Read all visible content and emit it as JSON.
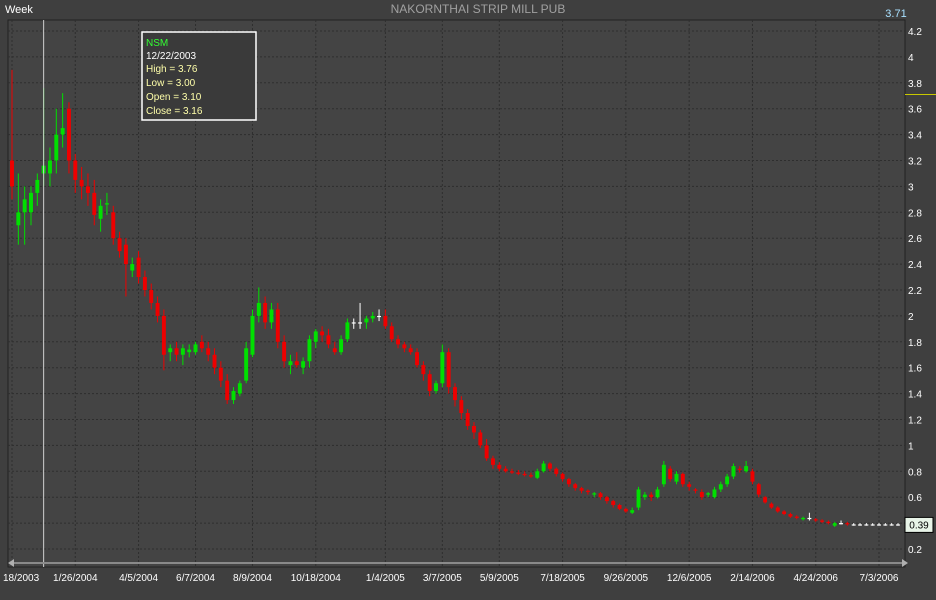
{
  "header": {
    "period_label": "Week",
    "title": "NAKORNTHAI STRIP MILL PUB",
    "last_value": "3.71"
  },
  "colors": {
    "background": "#3f3f3f",
    "plot_background": "#444444",
    "grid": "#2e2e2e",
    "up_candle": "#00e000",
    "down_candle": "#ee0000",
    "neutral_candle": "#ffffff",
    "axis_text": "#ffffff",
    "title_text": "#a0a0a0",
    "tooltip_symbol": "#33ff33",
    "tooltip_text": "#ffffaa",
    "current_price_line": "#c8c800",
    "last_badge_bg": "#e8f4e8",
    "crosshair": "#d0d0d0"
  },
  "tooltip": {
    "symbol": "NSM",
    "date": "12/22/2003",
    "high": "High  = 3.76",
    "low": "Low   = 3.00",
    "open": "Open = 3.10",
    "close": "Close = 3.16"
  },
  "last_price_badge": "0.39",
  "chart_data": {
    "type": "candlestick",
    "title": "NAKORNTHAI STRIP MILL PUB",
    "symbol": "NSM",
    "period": "Week",
    "ylim": [
      0.1,
      4.3
    ],
    "yticks": [
      0.2,
      0.4,
      0.6,
      0.8,
      1,
      1.2,
      1.4,
      1.6,
      1.8,
      2,
      2.2,
      2.4,
      2.6,
      2.8,
      3,
      3.2,
      3.4,
      3.6,
      3.8,
      4,
      4.2
    ],
    "ytick_labels": [
      "0.2",
      "0.4",
      "0.6",
      "0.8",
      "1",
      "1.2",
      "1.4",
      "1.6",
      "1.8",
      "2",
      "2.2",
      "2.4",
      "2.6",
      "2.8",
      "3",
      "3.2",
      "3.4",
      "3.6",
      "3.8",
      "4",
      "4.2"
    ],
    "xtick_labels": [
      "18/2003",
      "1/26/2004",
      "4/5/2004",
      "6/7/2004",
      "8/9/2004",
      "10/18/2004",
      "1/4/2005",
      "3/7/2005",
      "5/9/2005",
      "7/18/2005",
      "9/26/2005",
      "12/6/2005",
      "2/14/2006",
      "4/24/2006",
      "7/3/2006"
    ],
    "xtick_index": [
      0,
      10,
      20,
      29,
      38,
      48,
      59,
      68,
      77,
      87,
      97,
      107,
      117,
      127,
      137
    ],
    "highlight_index": 5,
    "current_price": 3.71,
    "last_close": 0.39,
    "ohlc": [
      {
        "o": 3.2,
        "h": 3.9,
        "l": 2.9,
        "c": 3.0
      },
      {
        "o": 2.7,
        "h": 3.1,
        "l": 2.55,
        "c": 2.8
      },
      {
        "o": 2.8,
        "h": 3.0,
        "l": 2.55,
        "c": 2.9
      },
      {
        "o": 2.8,
        "h": 3.0,
        "l": 2.7,
        "c": 2.95
      },
      {
        "o": 2.95,
        "h": 3.1,
        "l": 2.85,
        "c": 3.05
      },
      {
        "o": 3.1,
        "h": 3.76,
        "l": 3.0,
        "c": 3.16
      },
      {
        "o": 3.1,
        "h": 3.3,
        "l": 3.0,
        "c": 3.2
      },
      {
        "o": 3.2,
        "h": 3.6,
        "l": 3.1,
        "c": 3.4
      },
      {
        "o": 3.4,
        "h": 3.72,
        "l": 3.3,
        "c": 3.45
      },
      {
        "o": 3.6,
        "h": 3.65,
        "l": 3.1,
        "c": 3.2
      },
      {
        "o": 3.2,
        "h": 3.25,
        "l": 2.95,
        "c": 3.05
      },
      {
        "o": 3.05,
        "h": 3.15,
        "l": 2.9,
        "c": 3.0
      },
      {
        "o": 3.0,
        "h": 3.1,
        "l": 2.85,
        "c": 2.95
      },
      {
        "o": 2.95,
        "h": 3.05,
        "l": 2.7,
        "c": 2.78
      },
      {
        "o": 2.75,
        "h": 2.9,
        "l": 2.65,
        "c": 2.85
      },
      {
        "o": 2.86,
        "h": 2.95,
        "l": 2.78,
        "c": 2.87
      },
      {
        "o": 2.8,
        "h": 2.85,
        "l": 2.55,
        "c": 2.6
      },
      {
        "o": 2.6,
        "h": 2.65,
        "l": 2.45,
        "c": 2.5
      },
      {
        "o": 2.55,
        "h": 2.6,
        "l": 2.15,
        "c": 2.4
      },
      {
        "o": 2.35,
        "h": 2.45,
        "l": 2.3,
        "c": 2.4
      },
      {
        "o": 2.45,
        "h": 2.5,
        "l": 2.25,
        "c": 2.3
      },
      {
        "o": 2.3,
        "h": 2.35,
        "l": 2.15,
        "c": 2.2
      },
      {
        "o": 2.2,
        "h": 2.25,
        "l": 2.05,
        "c": 2.1
      },
      {
        "o": 2.1,
        "h": 2.15,
        "l": 1.95,
        "c": 2.0
      },
      {
        "o": 2.0,
        "h": 2.05,
        "l": 1.58,
        "c": 1.7
      },
      {
        "o": 1.72,
        "h": 1.78,
        "l": 1.65,
        "c": 1.75
      },
      {
        "o": 1.75,
        "h": 1.8,
        "l": 1.65,
        "c": 1.7
      },
      {
        "o": 1.7,
        "h": 1.78,
        "l": 1.62,
        "c": 1.75
      },
      {
        "o": 1.72,
        "h": 1.78,
        "l": 1.68,
        "c": 1.74
      },
      {
        "o": 1.72,
        "h": 1.8,
        "l": 1.7,
        "c": 1.78
      },
      {
        "o": 1.8,
        "h": 1.85,
        "l": 1.72,
        "c": 1.75
      },
      {
        "o": 1.75,
        "h": 1.8,
        "l": 1.65,
        "c": 1.7
      },
      {
        "o": 1.7,
        "h": 1.75,
        "l": 1.55,
        "c": 1.6
      },
      {
        "o": 1.6,
        "h": 1.65,
        "l": 1.45,
        "c": 1.5
      },
      {
        "o": 1.5,
        "h": 1.55,
        "l": 1.32,
        "c": 1.35
      },
      {
        "o": 1.35,
        "h": 1.45,
        "l": 1.32,
        "c": 1.42
      },
      {
        "o": 1.4,
        "h": 1.5,
        "l": 1.38,
        "c": 1.48
      },
      {
        "o": 1.5,
        "h": 1.8,
        "l": 1.48,
        "c": 1.75
      },
      {
        "o": 1.7,
        "h": 2.05,
        "l": 1.68,
        "c": 2.0
      },
      {
        "o": 2.0,
        "h": 2.22,
        "l": 1.95,
        "c": 2.1
      },
      {
        "o": 2.1,
        "h": 2.15,
        "l": 1.9,
        "c": 1.95
      },
      {
        "o": 1.95,
        "h": 2.1,
        "l": 1.9,
        "c": 2.05
      },
      {
        "o": 2.05,
        "h": 2.1,
        "l": 1.75,
        "c": 1.8
      },
      {
        "o": 1.8,
        "h": 1.85,
        "l": 1.6,
        "c": 1.65
      },
      {
        "o": 1.62,
        "h": 1.7,
        "l": 1.55,
        "c": 1.65
      },
      {
        "o": 1.65,
        "h": 1.72,
        "l": 1.6,
        "c": 1.62
      },
      {
        "o": 1.6,
        "h": 1.68,
        "l": 1.55,
        "c": 1.65
      },
      {
        "o": 1.65,
        "h": 1.85,
        "l": 1.6,
        "c": 1.82
      },
      {
        "o": 1.8,
        "h": 1.9,
        "l": 1.75,
        "c": 1.88
      },
      {
        "o": 1.88,
        "h": 1.92,
        "l": 1.8,
        "c": 1.85
      },
      {
        "o": 1.85,
        "h": 1.9,
        "l": 1.75,
        "c": 1.78
      },
      {
        "o": 1.75,
        "h": 1.8,
        "l": 1.7,
        "c": 1.72
      },
      {
        "o": 1.72,
        "h": 1.85,
        "l": 1.7,
        "c": 1.82
      },
      {
        "o": 1.82,
        "h": 1.98,
        "l": 1.8,
        "c": 1.95
      },
      {
        "o": 1.95,
        "h": 1.98,
        "l": 1.9,
        "c": 1.95
      },
      {
        "o": 1.95,
        "h": 2.1,
        "l": 1.9,
        "c": 1.95
      },
      {
        "o": 1.95,
        "h": 2.0,
        "l": 1.9,
        "c": 1.98
      },
      {
        "o": 1.98,
        "h": 2.03,
        "l": 1.95,
        "c": 2.0
      },
      {
        "o": 2.0,
        "h": 2.05,
        "l": 1.96,
        "c": 2.0
      },
      {
        "o": 2.0,
        "h": 2.05,
        "l": 1.9,
        "c": 1.92
      },
      {
        "o": 1.92,
        "h": 1.95,
        "l": 1.8,
        "c": 1.82
      },
      {
        "o": 1.82,
        "h": 1.85,
        "l": 1.75,
        "c": 1.78
      },
      {
        "o": 1.78,
        "h": 1.8,
        "l": 1.72,
        "c": 1.75
      },
      {
        "o": 1.75,
        "h": 1.78,
        "l": 1.7,
        "c": 1.72
      },
      {
        "o": 1.72,
        "h": 1.75,
        "l": 1.6,
        "c": 1.62
      },
      {
        "o": 1.62,
        "h": 1.65,
        "l": 1.5,
        "c": 1.55
      },
      {
        "o": 1.55,
        "h": 1.58,
        "l": 1.38,
        "c": 1.42
      },
      {
        "o": 1.42,
        "h": 1.5,
        "l": 1.4,
        "c": 1.48
      },
      {
        "o": 1.48,
        "h": 1.78,
        "l": 1.45,
        "c": 1.72
      },
      {
        "o": 1.72,
        "h": 1.75,
        "l": 1.4,
        "c": 1.45
      },
      {
        "o": 1.45,
        "h": 1.48,
        "l": 1.3,
        "c": 1.35
      },
      {
        "o": 1.35,
        "h": 1.38,
        "l": 1.2,
        "c": 1.25
      },
      {
        "o": 1.25,
        "h": 1.28,
        "l": 1.12,
        "c": 1.15
      },
      {
        "o": 1.15,
        "h": 1.18,
        "l": 1.05,
        "c": 1.1
      },
      {
        "o": 1.1,
        "h": 1.12,
        "l": 0.98,
        "c": 1.0
      },
      {
        "o": 1.0,
        "h": 1.05,
        "l": 0.88,
        "c": 0.9
      },
      {
        "o": 0.9,
        "h": 0.92,
        "l": 0.82,
        "c": 0.85
      },
      {
        "o": 0.85,
        "h": 0.87,
        "l": 0.8,
        "c": 0.82
      },
      {
        "o": 0.82,
        "h": 0.84,
        "l": 0.79,
        "c": 0.8
      },
      {
        "o": 0.8,
        "h": 0.82,
        "l": 0.78,
        "c": 0.79
      },
      {
        "o": 0.79,
        "h": 0.81,
        "l": 0.77,
        "c": 0.78
      },
      {
        "o": 0.78,
        "h": 0.8,
        "l": 0.76,
        "c": 0.77
      },
      {
        "o": 0.77,
        "h": 0.79,
        "l": 0.75,
        "c": 0.76
      },
      {
        "o": 0.75,
        "h": 0.82,
        "l": 0.74,
        "c": 0.8
      },
      {
        "o": 0.8,
        "h": 0.88,
        "l": 0.79,
        "c": 0.86
      },
      {
        "o": 0.86,
        "h": 0.87,
        "l": 0.8,
        "c": 0.82
      },
      {
        "o": 0.82,
        "h": 0.83,
        "l": 0.76,
        "c": 0.78
      },
      {
        "o": 0.78,
        "h": 0.79,
        "l": 0.72,
        "c": 0.74
      },
      {
        "o": 0.74,
        "h": 0.75,
        "l": 0.68,
        "c": 0.7
      },
      {
        "o": 0.7,
        "h": 0.71,
        "l": 0.65,
        "c": 0.67
      },
      {
        "o": 0.67,
        "h": 0.68,
        "l": 0.63,
        "c": 0.65
      },
      {
        "o": 0.65,
        "h": 0.66,
        "l": 0.62,
        "c": 0.64
      },
      {
        "o": 0.62,
        "h": 0.64,
        "l": 0.6,
        "c": 0.63
      },
      {
        "o": 0.63,
        "h": 0.64,
        "l": 0.58,
        "c": 0.6
      },
      {
        "o": 0.6,
        "h": 0.61,
        "l": 0.55,
        "c": 0.57
      },
      {
        "o": 0.57,
        "h": 0.58,
        "l": 0.52,
        "c": 0.54
      },
      {
        "o": 0.54,
        "h": 0.55,
        "l": 0.5,
        "c": 0.51
      },
      {
        "o": 0.51,
        "h": 0.52,
        "l": 0.48,
        "c": 0.49
      },
      {
        "o": 0.48,
        "h": 0.52,
        "l": 0.47,
        "c": 0.5
      },
      {
        "o": 0.52,
        "h": 0.68,
        "l": 0.5,
        "c": 0.66
      },
      {
        "o": 0.6,
        "h": 0.64,
        "l": 0.58,
        "c": 0.62
      },
      {
        "o": 0.62,
        "h": 0.64,
        "l": 0.57,
        "c": 0.6
      },
      {
        "o": 0.6,
        "h": 0.68,
        "l": 0.59,
        "c": 0.66
      },
      {
        "o": 0.7,
        "h": 0.88,
        "l": 0.68,
        "c": 0.85
      },
      {
        "o": 0.82,
        "h": 0.84,
        "l": 0.72,
        "c": 0.74
      },
      {
        "o": 0.72,
        "h": 0.8,
        "l": 0.7,
        "c": 0.78
      },
      {
        "o": 0.78,
        "h": 0.79,
        "l": 0.68,
        "c": 0.7
      },
      {
        "o": 0.7,
        "h": 0.72,
        "l": 0.65,
        "c": 0.68
      },
      {
        "o": 0.66,
        "h": 0.67,
        "l": 0.63,
        "c": 0.65
      },
      {
        "o": 0.64,
        "h": 0.66,
        "l": 0.58,
        "c": 0.6
      },
      {
        "o": 0.62,
        "h": 0.64,
        "l": 0.6,
        "c": 0.63
      },
      {
        "o": 0.6,
        "h": 0.68,
        "l": 0.59,
        "c": 0.66
      },
      {
        "o": 0.66,
        "h": 0.72,
        "l": 0.64,
        "c": 0.7
      },
      {
        "o": 0.7,
        "h": 0.78,
        "l": 0.68,
        "c": 0.76
      },
      {
        "o": 0.76,
        "h": 0.86,
        "l": 0.74,
        "c": 0.84
      },
      {
        "o": 0.82,
        "h": 0.84,
        "l": 0.79,
        "c": 0.81
      },
      {
        "o": 0.8,
        "h": 0.88,
        "l": 0.79,
        "c": 0.84
      },
      {
        "o": 0.8,
        "h": 0.82,
        "l": 0.7,
        "c": 0.72
      },
      {
        "o": 0.7,
        "h": 0.71,
        "l": 0.6,
        "c": 0.62
      },
      {
        "o": 0.6,
        "h": 0.61,
        "l": 0.55,
        "c": 0.56
      },
      {
        "o": 0.55,
        "h": 0.56,
        "l": 0.51,
        "c": 0.52
      },
      {
        "o": 0.52,
        "h": 0.53,
        "l": 0.48,
        "c": 0.49
      },
      {
        "o": 0.49,
        "h": 0.5,
        "l": 0.46,
        "c": 0.47
      },
      {
        "o": 0.47,
        "h": 0.48,
        "l": 0.44,
        "c": 0.45
      },
      {
        "o": 0.45,
        "h": 0.46,
        "l": 0.43,
        "c": 0.44
      },
      {
        "o": 0.43,
        "h": 0.45,
        "l": 0.42,
        "c": 0.44
      },
      {
        "o": 0.44,
        "h": 0.48,
        "l": 0.42,
        "c": 0.44
      },
      {
        "o": 0.43,
        "h": 0.44,
        "l": 0.41,
        "c": 0.42
      },
      {
        "o": 0.42,
        "h": 0.43,
        "l": 0.4,
        "c": 0.41
      },
      {
        "o": 0.41,
        "h": 0.42,
        "l": 0.39,
        "c": 0.4
      },
      {
        "o": 0.38,
        "h": 0.41,
        "l": 0.37,
        "c": 0.4
      },
      {
        "o": 0.4,
        "h": 0.42,
        "l": 0.39,
        "c": 0.4
      },
      {
        "o": 0.4,
        "h": 0.41,
        "l": 0.38,
        "c": 0.39
      },
      {
        "o": 0.39,
        "h": 0.4,
        "l": 0.38,
        "c": 0.39
      },
      {
        "o": 0.39,
        "h": 0.4,
        "l": 0.38,
        "c": 0.39
      },
      {
        "o": 0.39,
        "h": 0.4,
        "l": 0.38,
        "c": 0.39
      },
      {
        "o": 0.39,
        "h": 0.4,
        "l": 0.38,
        "c": 0.39
      },
      {
        "o": 0.39,
        "h": 0.4,
        "l": 0.38,
        "c": 0.39
      },
      {
        "o": 0.39,
        "h": 0.4,
        "l": 0.38,
        "c": 0.39
      },
      {
        "o": 0.39,
        "h": 0.4,
        "l": 0.38,
        "c": 0.39
      },
      {
        "o": 0.39,
        "h": 0.4,
        "l": 0.38,
        "c": 0.39
      }
    ]
  }
}
